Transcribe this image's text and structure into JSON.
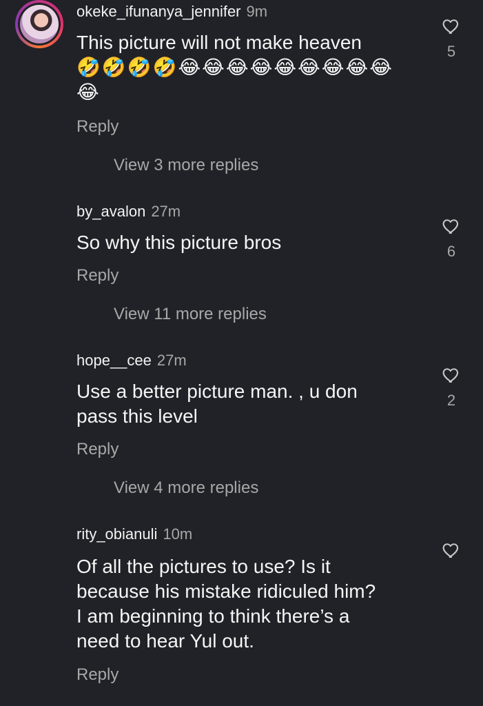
{
  "comments": [
    {
      "username": "okeke_ifunanya_jennifer",
      "time": "9m",
      "text": "This picture will not make heaven",
      "emojis_line1": "🤣🤣🤣🤣😂😂😂😂😂😂😂😂😂",
      "emojis_line2": "😂",
      "reply": "Reply",
      "view_more": "View 3 more replies",
      "likes": "5"
    },
    {
      "username": "by_avalon",
      "time": "27m",
      "text": "So why this picture bros",
      "reply": "Reply",
      "view_more": "View 11 more replies",
      "likes": "6"
    },
    {
      "username": "hope__cee",
      "time": "27m",
      "text_line1": "Use a better picture man. , u don",
      "text_line2": "pass this level",
      "reply": "Reply",
      "view_more": "View 4 more replies",
      "likes": "2"
    },
    {
      "username": "rity_obianuli",
      "time": "10m",
      "text_line1": "Of all the pictures to use? Is it",
      "text_line2": "because his mistake ridiculed him?",
      "text_line3": "I am beginning to think there’s a",
      "text_line4": "need to hear Yul out.",
      "reply": "Reply"
    }
  ],
  "icons": {
    "like": "heart-outline-icon",
    "avatar": "user-avatar"
  },
  "colors": {
    "background": "#212227",
    "primary_text": "#f3f3f3",
    "secondary_text": "#a8a8a8"
  }
}
